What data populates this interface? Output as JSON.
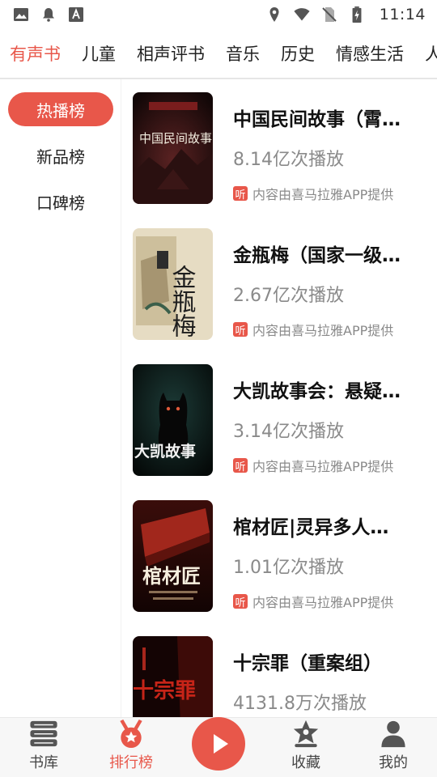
{
  "status_bar": {
    "time": "11:14",
    "left_icons": [
      "image-icon",
      "notification-bell-icon",
      "font-icon"
    ],
    "right_icons": [
      "location-icon",
      "wifi-icon",
      "no-sim-icon",
      "battery-charging-icon"
    ]
  },
  "category_tabs": [
    {
      "label": "有声书",
      "active": true
    },
    {
      "label": "儿童",
      "active": false
    },
    {
      "label": "相声评书",
      "active": false
    },
    {
      "label": "音乐",
      "active": false
    },
    {
      "label": "历史",
      "active": false
    },
    {
      "label": "情感生活",
      "active": false
    },
    {
      "label": "人文",
      "active": false
    }
  ],
  "rank_tabs": [
    {
      "label": "热播榜",
      "active": true
    },
    {
      "label": "新品榜",
      "active": false
    },
    {
      "label": "口碑榜",
      "active": false
    }
  ],
  "books": [
    {
      "title": "中国民间故事（霄…",
      "plays": "8.14亿次播放",
      "source": "内容由喜马拉雅APP提供",
      "cover_text": "中国民间故事"
    },
    {
      "title": "金瓶梅（国家一级…",
      "plays": "2.67亿次播放",
      "source": "内容由喜马拉雅APP提供",
      "cover_text": "金瓶梅"
    },
    {
      "title": "大凯故事会：悬疑…",
      "plays": "3.14亿次播放",
      "source": "内容由喜马拉雅APP提供",
      "cover_text": "大凯故事"
    },
    {
      "title": "棺材匠|灵异多人…",
      "plays": "1.01亿次播放",
      "source": "内容由喜马拉雅APP提供",
      "cover_text": "棺材匠"
    },
    {
      "title": "十宗罪（重案组）",
      "plays": "4131.8万次播放",
      "source": "",
      "cover_text": "十宗罪"
    }
  ],
  "listen_badge": "听",
  "bottom_nav": [
    {
      "label": "书库",
      "icon": "bookshelf-icon",
      "active": false
    },
    {
      "label": "排行榜",
      "icon": "medal-icon",
      "active": true
    },
    {
      "label": "收藏",
      "icon": "star-user-icon",
      "active": false
    },
    {
      "label": "我的",
      "icon": "profile-icon",
      "active": false
    }
  ],
  "colors": {
    "accent": "#e8574a",
    "text": "#222222",
    "muted": "#8a8a8a"
  }
}
